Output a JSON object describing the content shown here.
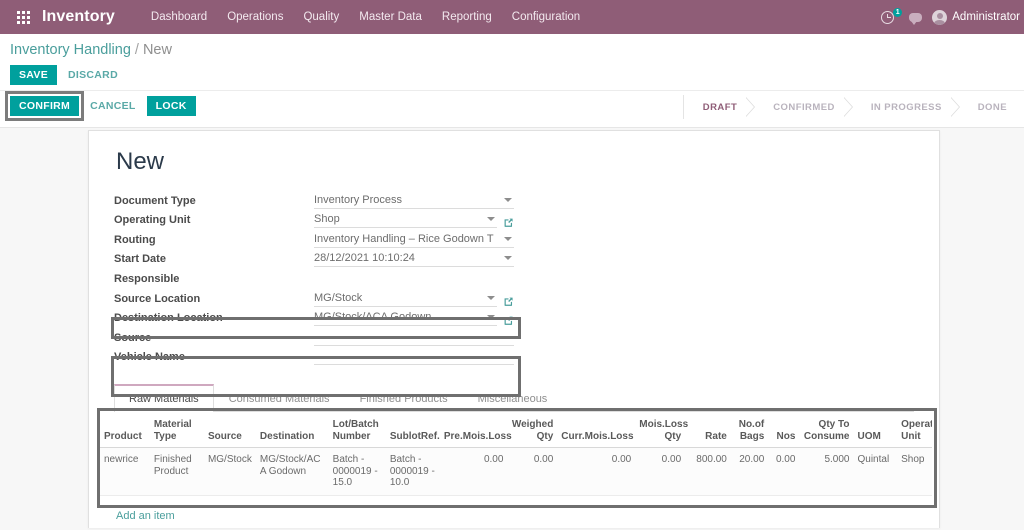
{
  "navbar": {
    "apps_icon": "apps-grid-icon",
    "brand": "Inventory",
    "menus": [
      "Dashboard",
      "Operations",
      "Quality",
      "Master Data",
      "Reporting",
      "Configuration"
    ],
    "activity_icon": "clock-icon",
    "activity_count": "1",
    "messages_icon": "chat-bubble-icon",
    "avatar_icon": "user-avatar-icon",
    "user_name": "Administrator"
  },
  "breadcrumb": {
    "parent": "Inventory Handling",
    "separator": "/",
    "current": "New"
  },
  "toolbar": {
    "save_label": "SAVE",
    "discard_label": "DISCARD",
    "confirm_label": "CONFIRM",
    "cancel_label": "CANCEL",
    "lock_label": "LOCK"
  },
  "pipeline": {
    "steps": [
      "DRAFT",
      "CONFIRMED",
      "IN PROGRESS",
      "DONE"
    ],
    "active": "DRAFT"
  },
  "record": {
    "title": "New",
    "fields": [
      {
        "label": "Document Type",
        "value": "Inventory Process",
        "widget": "dropdown"
      },
      {
        "label": "Operating Unit",
        "value": "Shop",
        "widget": "dropdown-link"
      },
      {
        "label": "Routing",
        "value": "Inventory Handling – Rice Godown T",
        "widget": "dropdown"
      },
      {
        "label": "Start Date",
        "value": "28/12/2021 10:10:24",
        "widget": "dropdown"
      },
      {
        "label": "Responsible",
        "value": "",
        "widget": "blank"
      },
      {
        "label": "Source Location",
        "value": "MG/Stock",
        "widget": "dropdown-link"
      },
      {
        "label": "Destination Location",
        "value": "MG/Stock/ACA Godown",
        "widget": "dropdown-link"
      },
      {
        "label": "Source",
        "value": "",
        "widget": "text"
      },
      {
        "label": "Vehicle Name",
        "value": "",
        "widget": "text"
      }
    ]
  },
  "tabs": {
    "items": [
      "Raw Materials",
      "Consumed Materials",
      "Finished Products",
      "Miscellaneous"
    ],
    "active": "Raw Materials"
  },
  "lines_table": {
    "columns": [
      "Product",
      "Material Type",
      "Source",
      "Destination",
      "Lot/Batch Number",
      "SublotRef.",
      "Pre.Mois.Loss",
      "Weighed Qty",
      "Curr.Mois.Loss",
      "Mois.Loss Qty",
      "Rate",
      "No.of Bags",
      "Nos",
      "Qty To Consume",
      "UOM",
      "Operating Unit"
    ],
    "rows": [
      {
        "product": "newrice",
        "material_type": "Finished Product",
        "source": "MG/Stock",
        "destination": "MG/Stock/ACA Godown",
        "lot_batch_number": "Batch - 0000019 - 15.0",
        "sublot_ref": "Batch - 0000019 - 10.0",
        "pre_mois_loss": "0.00",
        "weighed_qty": "0.00",
        "curr_mois_loss": "0.00",
        "mois_loss_qty": "0.00",
        "rate": "800.00",
        "no_of_bags": "20.00",
        "nos": "0.00",
        "qty_to_consume": "5.000",
        "uom": "Quintal",
        "operating_unit": "Shop"
      }
    ],
    "add_item_label": "Add an item"
  },
  "colors": {
    "brand_purple": "#8f5d77",
    "accent_teal": "#00a09d",
    "link_teal": "#4a9e9c",
    "highlight_box": "#6f6f6f",
    "page_bg": "#f7f7f7"
  }
}
